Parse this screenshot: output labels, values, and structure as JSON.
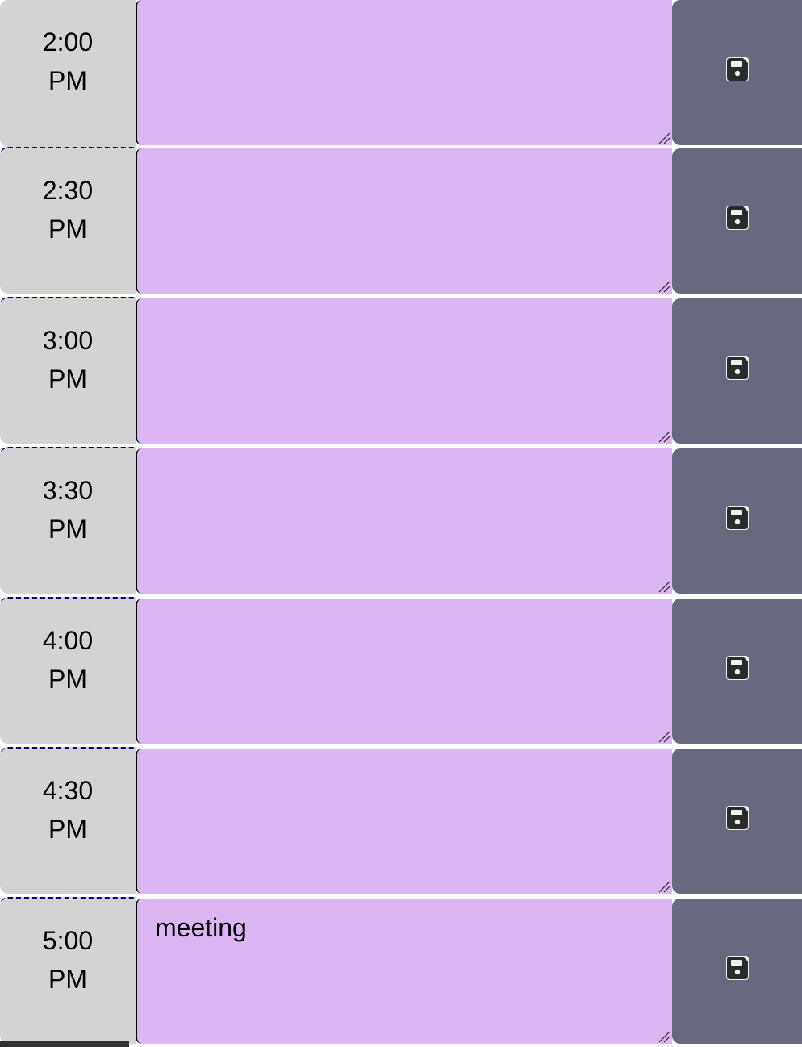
{
  "time_blocks": [
    {
      "hour_line1": "2:00",
      "hour_line2": "PM",
      "description": ""
    },
    {
      "hour_line1": "2:30",
      "hour_line2": "PM",
      "description": ""
    },
    {
      "hour_line1": "3:00",
      "hour_line2": "PM",
      "description": ""
    },
    {
      "hour_line1": "3:30",
      "hour_line2": "PM",
      "description": ""
    },
    {
      "hour_line1": "4:00",
      "hour_line2": "PM",
      "description": ""
    },
    {
      "hour_line1": "4:30",
      "hour_line2": "PM",
      "description": ""
    },
    {
      "hour_line1": "5:00",
      "hour_line2": "PM",
      "description": "meeting"
    }
  ],
  "icons": {
    "save": "save-icon"
  },
  "colors": {
    "hour_bg": "#d3d3d3",
    "future_bg": "#dab6f2",
    "save_bg": "#676a7f",
    "separator": "#000080"
  }
}
